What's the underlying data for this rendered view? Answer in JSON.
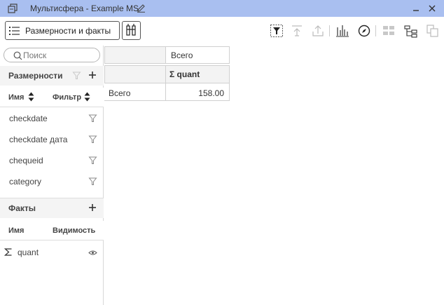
{
  "titlebar": {
    "title": "Мультисфера - Example MS",
    "icons": [
      "window-icon",
      "edit-icon",
      "minimize-icon",
      "close-icon"
    ]
  },
  "toolbar": {
    "dims_button_label": "Размерности и факты",
    "icons": [
      "list-icon",
      "sort-columns-icon",
      "filter-icon",
      "export-icon",
      "upload-icon",
      "chart-icon",
      "compass-icon",
      "grid-icon",
      "tree-icon",
      "copy-icon"
    ]
  },
  "sidebar": {
    "search_placeholder": "Поиск",
    "dimensions": {
      "title": "Размерности",
      "col_name": "Имя",
      "col_filter": "Фильтр",
      "items": [
        {
          "label": "checkdate"
        },
        {
          "label": "checkdate дата"
        },
        {
          "label": "chequeid"
        },
        {
          "label": "category"
        }
      ]
    },
    "facts": {
      "title": "Факты",
      "col_name": "Имя",
      "col_visibility": "Видимость",
      "items": [
        {
          "label": "quant",
          "icon": "sigma-icon"
        }
      ]
    }
  },
  "pivot": {
    "col_header_total": "Всего",
    "measure_header": "Σ quant",
    "row_total_label": "Всего",
    "row_total_value": "158.00"
  },
  "colors": {
    "titlebar_bg": "#a9bff0",
    "border": "#d0d0d0",
    "header_bg": "#f3f3f3"
  }
}
